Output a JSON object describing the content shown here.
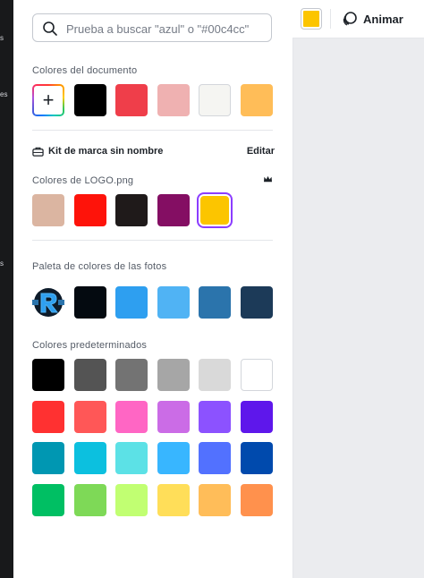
{
  "search": {
    "placeholder": "Prueba a buscar \"azul\" o \"#00c4cc\""
  },
  "left_rail_fragments": [
    "s",
    "es",
    "s"
  ],
  "sections": {
    "document": {
      "title": "Colores del documento",
      "colors": [
        "#000000",
        "#ef3e4a",
        "#efb1b1",
        "#f5f5f2",
        "#ffbd58"
      ]
    },
    "brand": {
      "kit_label": "Kit de marca sin nombre",
      "edit_label": "Editar",
      "logo_title": "Colores de LOGO.png",
      "logo_colors": [
        "#dbb5a1",
        "#fe130a",
        "#1f1a1a",
        "#840e63",
        "#fcc500"
      ],
      "selected_index": 4
    },
    "photos": {
      "title": "Paleta de colores de las fotos",
      "colors": [
        "#040a10",
        "#2e9ff0",
        "#50b3f4",
        "#2b74ac",
        "#1c3a58"
      ]
    },
    "defaults": {
      "title": "Colores predeterminados",
      "rows": [
        [
          "#000000",
          "#545454",
          "#737373",
          "#a6a6a6",
          "#d9d9d9",
          "#ffffff"
        ],
        [
          "#ff3131",
          "#ff5757",
          "#ff66c4",
          "#cb6ce6",
          "#8c52ff",
          "#5e17eb"
        ],
        [
          "#0097b2",
          "#0cc0df",
          "#5ce1e6",
          "#38b6ff",
          "#5271ff",
          "#004aad"
        ],
        [
          "#00bf63",
          "#7ed957",
          "#c1ff72",
          "#ffde59",
          "#ffbd59",
          "#ff914d"
        ]
      ]
    }
  },
  "topbar": {
    "current_color": "#fcc500",
    "animate_label": "Animar"
  }
}
